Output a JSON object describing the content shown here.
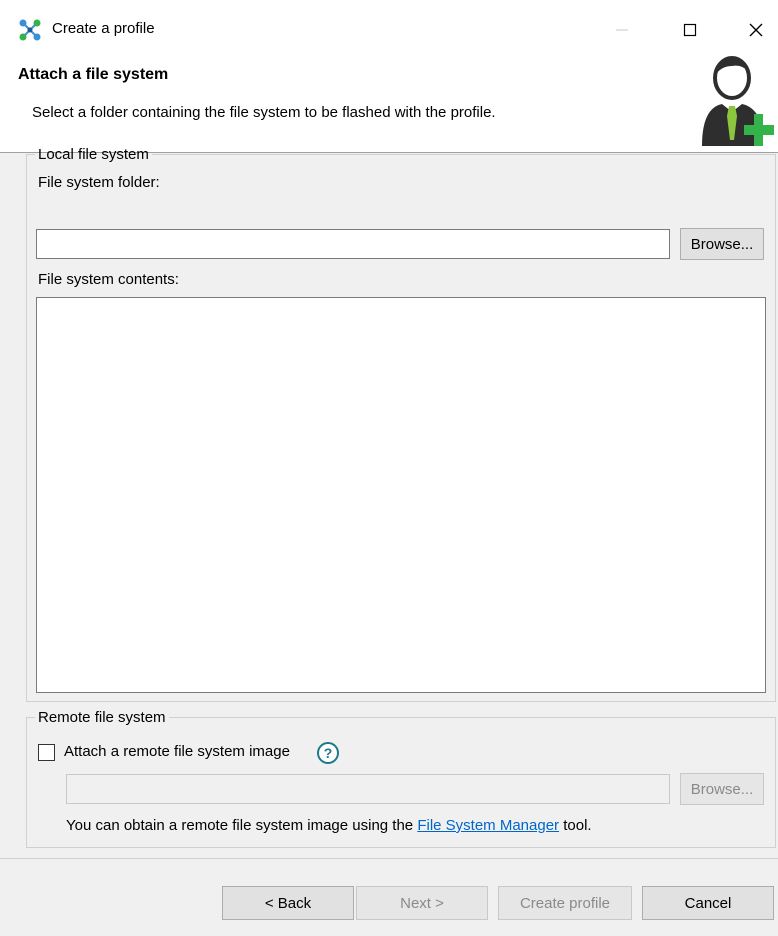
{
  "window": {
    "title": "Create a profile",
    "controls": [
      "minimize",
      "maximize",
      "close"
    ]
  },
  "header": {
    "heading": "Attach a file system",
    "description": "Select a folder containing the file system to be flashed with the profile.",
    "icon": "add-user-icon"
  },
  "local": {
    "legend": "Local file system",
    "folder_label": "File system folder:",
    "folder_value": "",
    "browse_label": "Browse...",
    "contents_label": "File system contents:"
  },
  "remote": {
    "legend": "Remote file system",
    "checkbox_label": "Attach a remote file system image",
    "checked": false,
    "input_value": "",
    "browse_label": "Browse...",
    "note_prefix": "You can obtain a remote file system image using the ",
    "note_link": "File System Manager",
    "note_suffix": " tool."
  },
  "buttons": {
    "back": "< Back",
    "next": "Next >",
    "create": "Create profile",
    "cancel": "Cancel"
  },
  "colors": {
    "accent_green": "#33b34a",
    "link": "#0066cc",
    "help_teal": "#1c7a8a"
  }
}
